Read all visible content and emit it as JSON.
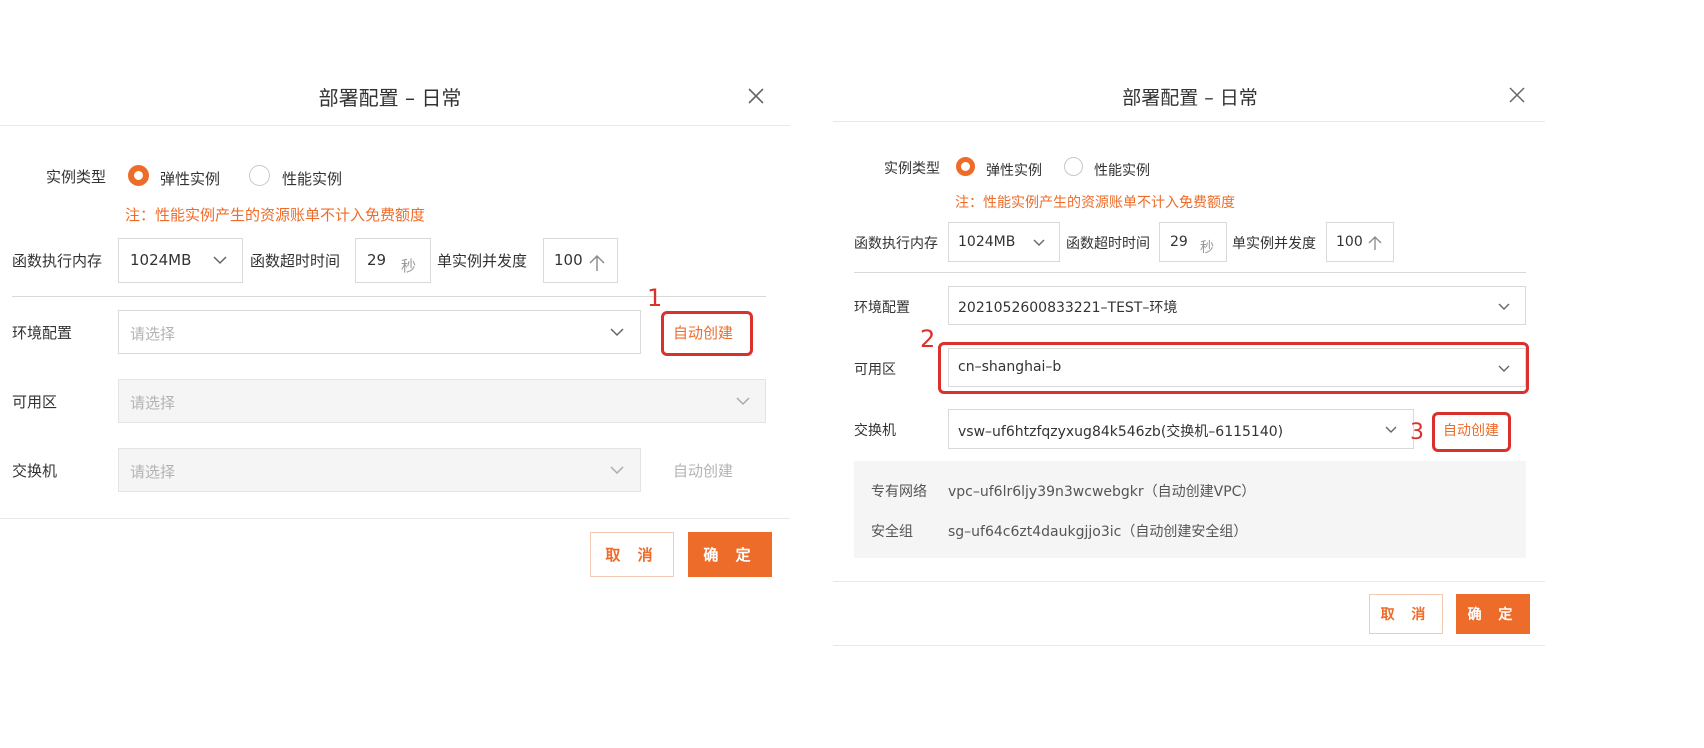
{
  "left_dialog": {
    "title": "部署配置 – 日常",
    "instance_type": {
      "label": "实例类型",
      "option_elastic": "弹性实例",
      "option_performance": "性能实例",
      "selected": "弹性实例"
    },
    "note": "注：性能实例产生的资源账单不计入免费额度",
    "memory": {
      "label": "函数执行内存",
      "value": "1024MB"
    },
    "timeout": {
      "label": "函数超时时间",
      "value": "29",
      "unit": "秒"
    },
    "concurrency": {
      "label": "单实例并发度",
      "value": "100",
      "unit": "个"
    },
    "env": {
      "label": "环境配置",
      "placeholder": "请选择",
      "auto_create": "自动创建"
    },
    "zone": {
      "label": "可用区",
      "placeholder": "请选择"
    },
    "switch": {
      "label": "交换机",
      "placeholder": "请选择",
      "auto_create": "自动创建"
    },
    "cancel": "取 消",
    "confirm": "确 定",
    "marker": "1"
  },
  "right_dialog": {
    "title": "部署配置 – 日常",
    "instance_type": {
      "label": "实例类型",
      "option_elastic": "弹性实例",
      "option_performance": "性能实例",
      "selected": "弹性实例"
    },
    "note": "注：性能实例产生的资源账单不计入免费额度",
    "memory": {
      "label": "函数执行内存",
      "value": "1024MB"
    },
    "timeout": {
      "label": "函数超时时间",
      "value": "29",
      "unit": "秒"
    },
    "concurrency": {
      "label": "单实例并发度",
      "value": "100",
      "unit": "个"
    },
    "env": {
      "label": "环境配置",
      "value": "2021052600833221–TEST–环境"
    },
    "zone": {
      "label": "可用区",
      "value": "cn–shanghai–b"
    },
    "switch": {
      "label": "交换机",
      "value": "vsw–uf6htzfqzyxug84k546zb(交换机–6115140)",
      "auto_create": "自动创建"
    },
    "vpc": {
      "label": "专有网络",
      "value": "vpc–uf6lr6ljy39n3wcwebgkr（自动创建VPC）"
    },
    "security_group": {
      "label": "安全组",
      "value": "sg–uf64c6zt4daukgjjo3ic（自动创建安全组）"
    },
    "cancel": "取 消",
    "confirm": "确 定",
    "marker_zone": "2",
    "marker_switch": "3"
  },
  "colors": {
    "accent": "#ee6c2a",
    "highlight_red": "#d9312b",
    "border": "#d9d9d9",
    "disabled_bg": "#f5f5f5"
  },
  "icons": {
    "close": "close-icon",
    "dropdown": "chevron-down-icon",
    "stepper": "arrow-up-icon"
  }
}
